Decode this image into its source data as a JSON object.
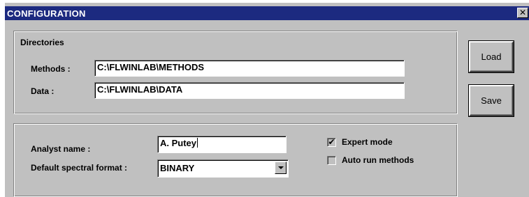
{
  "window": {
    "title": "CONFIGURATION",
    "close_glyph": "✕"
  },
  "directories": {
    "legend": "Directories",
    "methods_label": "Methods :",
    "methods_value": "C:\\FLWINLAB\\METHODS",
    "data_label": "Data :",
    "data_value": "C:\\FLWINLAB\\DATA"
  },
  "settings": {
    "analyst_label": "Analyst name :",
    "analyst_value": "A. Putey",
    "format_label": "Default spectral format :",
    "format_value": "BINARY",
    "expert_mode_label": "Expert mode",
    "expert_mode_checked": true,
    "auto_run_label": "Auto run methods",
    "auto_run_checked": false,
    "check_glyph": "✔"
  },
  "buttons": {
    "load_label": "Load",
    "save_label": "Save"
  }
}
